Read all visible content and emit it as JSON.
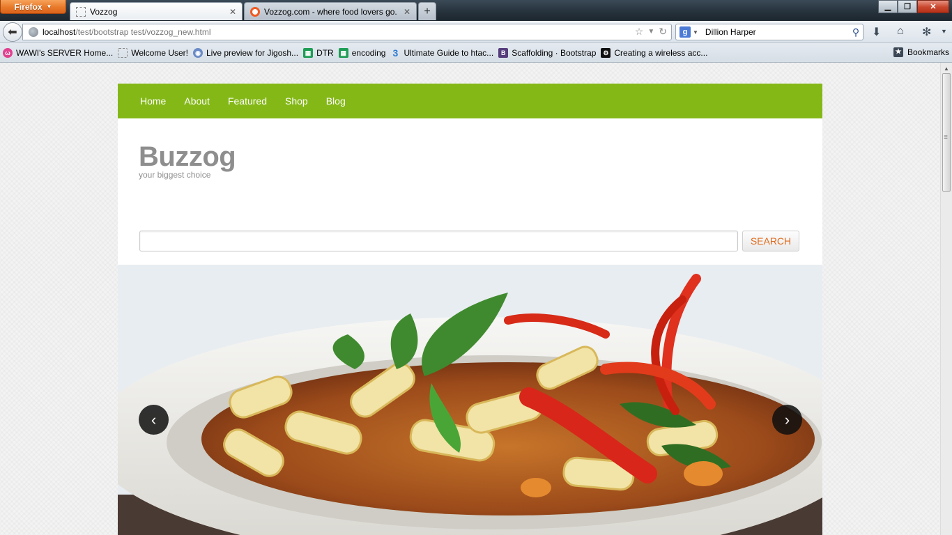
{
  "browser": {
    "app_button": "Firefox",
    "tabs": [
      {
        "title": "Vozzog"
      },
      {
        "title": "Vozzog.com - where food lovers go."
      }
    ],
    "new_tab": "+",
    "url": {
      "host": "localhost",
      "path": "/test/bootstrap test/vozzog_new.html"
    },
    "search_engine_letter": "g",
    "search_value": "Dillion Harper",
    "bookmarks": [
      {
        "label": "WAWI's SERVER Home...",
        "icon": "server-icon"
      },
      {
        "label": "Welcome User!",
        "icon": "blank-page-icon"
      },
      {
        "label": "Live preview for Jigosh...",
        "icon": "cat-icon"
      },
      {
        "label": "DTR",
        "icon": "spreadsheet-icon"
      },
      {
        "label": "encoding",
        "icon": "spreadsheet-icon"
      },
      {
        "label": "Ultimate Guide to htac...",
        "icon": "css3-icon"
      },
      {
        "label": "Scaffolding · Bootstrap",
        "icon": "bootstrap-icon"
      },
      {
        "label": "Creating a wireless acc...",
        "icon": "bw-icon"
      }
    ],
    "bookmarks_menu": "Bookmarks"
  },
  "site": {
    "nav": [
      "Home",
      "About",
      "Featured",
      "Shop",
      "Blog"
    ],
    "brand": "Buzzog",
    "tagline": "your biggest choice",
    "search_placeholder": "",
    "search_button": "SEARCH",
    "colors": {
      "nav": "#84b817",
      "brand": "#8e8e8e",
      "search_button_text": "#e06a1b"
    }
  }
}
